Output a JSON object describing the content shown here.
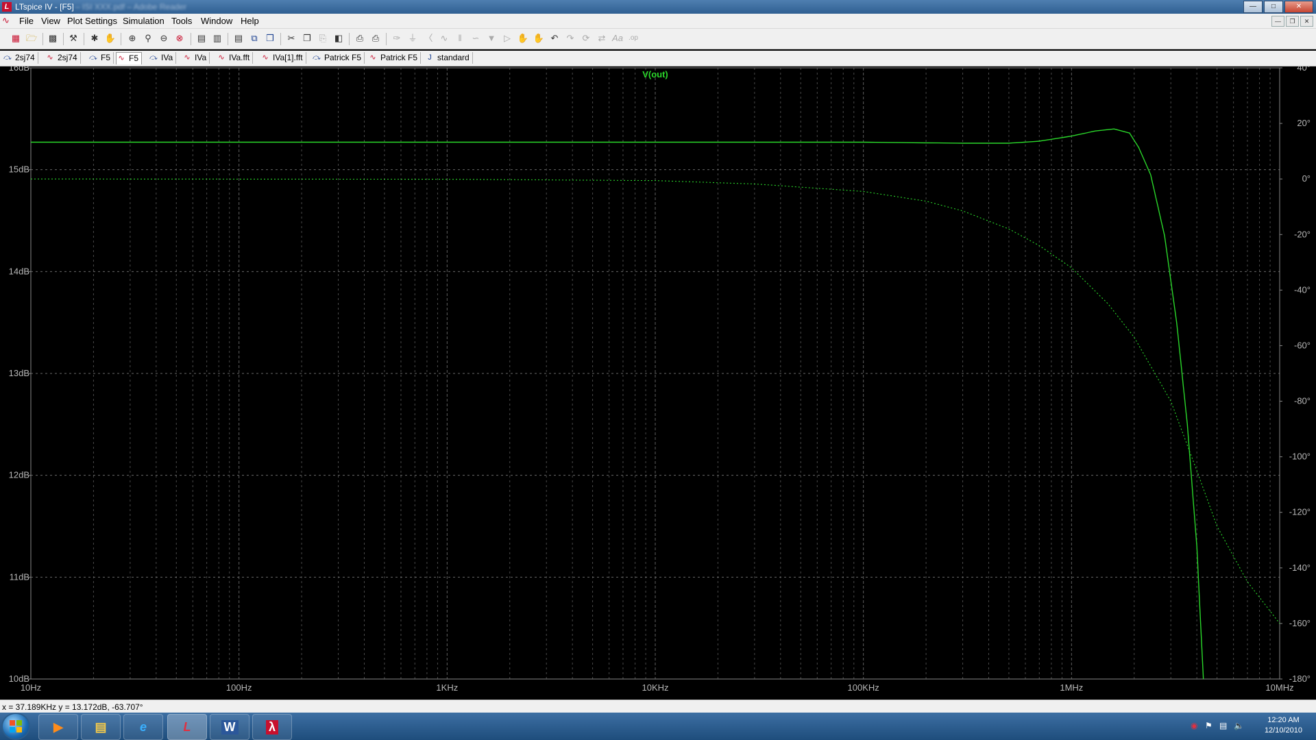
{
  "window": {
    "title": "LTspice IV - [F5]",
    "blurred_title": "– ISI XXX.pdf – Adobe Reader",
    "buttons": [
      "minimize",
      "maximize",
      "close"
    ]
  },
  "menubar": {
    "items": [
      "File",
      "View",
      "Plot Settings",
      "Simulation",
      "Tools",
      "Window",
      "Help"
    ]
  },
  "toolbar": {
    "icons": [
      "new-schematic-icon",
      "open-icon",
      "save-icon",
      "control-panel-icon",
      "run-icon",
      "halt-icon",
      "zoom-in-icon",
      "zoom-out-icon",
      "pan-icon",
      "zoom-full-icon",
      "autorange-icon",
      "manual-limits-icon",
      "tile-horizontal-icon",
      "tile-vertical-icon",
      "cascade-icon",
      "cut-icon",
      "copy-icon",
      "paste-icon",
      "find-icon",
      "print-setup-icon",
      "print-icon",
      "wire-icon",
      "ground-icon",
      "label-icon",
      "resistor-icon",
      "capacitor-icon",
      "inductor-icon",
      "diode-icon",
      "component-icon",
      "move-icon",
      "drag-icon",
      "undo-icon",
      "redo-icon",
      "rotate-icon",
      "mirror-icon",
      "text-icon",
      "spice-directive-icon"
    ]
  },
  "tabs": [
    {
      "label": "2sj74",
      "type": "schematic"
    },
    {
      "label": "2sj74",
      "type": "waveform"
    },
    {
      "label": "F5",
      "type": "schematic"
    },
    {
      "label": "F5",
      "type": "waveform",
      "active": true
    },
    {
      "label": "IVa",
      "type": "schematic"
    },
    {
      "label": "IVa",
      "type": "waveform"
    },
    {
      "label": "IVa.fft",
      "type": "waveform"
    },
    {
      "label": "IVa[1].fft",
      "type": "waveform"
    },
    {
      "label": "Patrick F5",
      "type": "schematic"
    },
    {
      "label": "Patrick F5",
      "type": "waveform"
    },
    {
      "label": "standard",
      "type": "symbol"
    }
  ],
  "plot": {
    "trace_label": "V(out)",
    "trace_color": "#2ad82a",
    "grid_color": "#6a6a6a",
    "background": "#000000",
    "left_ticks": [
      "16dB",
      "15dB",
      "14dB",
      "13dB",
      "12dB",
      "11dB",
      "10dB"
    ],
    "right_ticks": [
      "40°",
      "20°",
      "0°",
      "-20°",
      "-40°",
      "-60°",
      "-80°",
      "-100°",
      "-120°",
      "-140°",
      "-160°",
      "-180°"
    ],
    "x_ticks": [
      "10Hz",
      "100Hz",
      "1KHz",
      "10KHz",
      "100KHz",
      "1MHz",
      "10MHz"
    ]
  },
  "chart_data": {
    "type": "line",
    "xscale": "log",
    "xlim": [
      10,
      10000000
    ],
    "ylim_left": [
      10,
      16
    ],
    "ylim_right": [
      -180,
      40
    ],
    "grid": true,
    "series": [
      {
        "name": "V(out)",
        "axis": "left",
        "unit": "dB",
        "style": "solid",
        "x": [
          10,
          1000,
          100000,
          300000,
          500000,
          700000,
          1000000,
          1300000,
          1600000,
          1900000,
          2100000,
          2400000,
          2800000,
          3200000,
          3600000,
          4000000,
          4300000
        ],
        "values": [
          15.27,
          15.27,
          15.27,
          15.26,
          15.26,
          15.28,
          15.33,
          15.38,
          15.4,
          15.36,
          15.22,
          14.95,
          14.35,
          13.5,
          12.5,
          11.3,
          10.0
        ]
      },
      {
        "name": "V(out) phase",
        "axis": "right",
        "unit": "deg",
        "style": "dashed",
        "x": [
          10,
          1000,
          10000,
          30000,
          100000,
          200000,
          300000,
          500000,
          700000,
          1000000,
          1500000,
          2000000,
          3000000,
          4000000,
          5000000,
          7000000,
          10000000
        ],
        "values": [
          0,
          -0.1,
          -0.6,
          -1.8,
          -4.5,
          -8.0,
          -11.5,
          -18,
          -24,
          -32,
          -45,
          -57,
          -80,
          -105,
          -125,
          -145,
          -160
        ]
      }
    ]
  },
  "status": {
    "cursor_text": "x = 37.189KHz    y = 13.172dB, -63.707°"
  },
  "taskbar": {
    "apps": [
      "media-player-icon",
      "explorer-icon",
      "internet-explorer-icon",
      "ltspice-icon",
      "word-icon",
      "acrobat-icon"
    ],
    "tray_icons": [
      "antivirus-icon",
      "action-center-icon",
      "network-icon",
      "volume-icon"
    ],
    "time": "12:20 AM",
    "date": "12/10/2010"
  }
}
